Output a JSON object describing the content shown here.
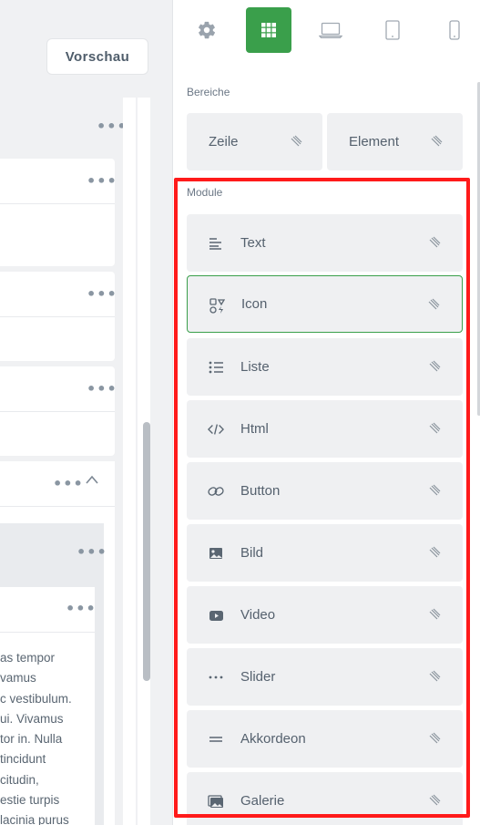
{
  "left": {
    "preview_label": "Vorschau",
    "more_glyph": "•••",
    "chevron_icon": "chevron-up-icon",
    "lorem_lines": [
      "as tempor",
      "vamus",
      "c vestibulum.",
      "ui. Vivamus",
      "tor in. Nulla",
      "tincidunt",
      "citudin,",
      "estie turpis",
      "lacinia purus"
    ]
  },
  "panel": {
    "tabs": [
      {
        "icon": "gear-icon",
        "active": false
      },
      {
        "icon": "grid-icon",
        "active": true
      },
      {
        "icon": "laptop-icon",
        "active": false
      },
      {
        "icon": "tablet-icon",
        "active": false
      },
      {
        "icon": "phone-icon",
        "active": false
      }
    ],
    "areas_title": "Bereiche",
    "areas": [
      {
        "label": "Zeile"
      },
      {
        "label": "Element"
      }
    ],
    "modules_title": "Module",
    "modules": [
      {
        "label": "Text",
        "icon": "text-align-icon",
        "selected": false
      },
      {
        "label": "Icon",
        "icon": "icon-shapes-icon",
        "selected": true
      },
      {
        "label": "Liste",
        "icon": "list-icon",
        "selected": false
      },
      {
        "label": "Html",
        "icon": "code-icon",
        "selected": false
      },
      {
        "label": "Button",
        "icon": "link-icon",
        "selected": false
      },
      {
        "label": "Bild",
        "icon": "image-icon",
        "selected": false
      },
      {
        "label": "Video",
        "icon": "video-icon",
        "selected": false
      },
      {
        "label": "Slider",
        "icon": "dots-icon",
        "selected": false
      },
      {
        "label": "Akkordeon",
        "icon": "accordion-icon",
        "selected": false
      },
      {
        "label": "Galerie",
        "icon": "gallery-icon",
        "selected": false
      }
    ]
  },
  "colors": {
    "accent": "#3a9f4b",
    "highlight": "#ff1a1a"
  }
}
